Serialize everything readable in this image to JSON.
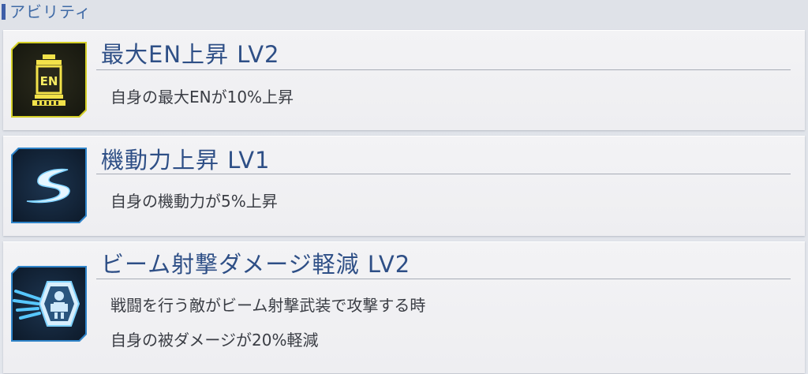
{
  "section": {
    "title": "アビリティ"
  },
  "abilities": [
    {
      "icon": "en-battery-icon",
      "title": "最大EN上昇 LV2",
      "description_lines": [
        "自身の最大ENが10%上昇"
      ],
      "icon_label": "EN",
      "frame_color": "#d4cf28"
    },
    {
      "icon": "mobility-swoosh-icon",
      "title": "機動力上昇 LV1",
      "description_lines": [
        "自身の機動力が5%上昇"
      ],
      "frame_color": "#2f84c9"
    },
    {
      "icon": "beam-shield-icon",
      "title": "ビーム射撃ダメージ軽減 LV2",
      "description_lines": [
        "戦闘を行う敵がビーム射撃武装で攻撃する時",
        "自身の被ダメージが20%軽減"
      ],
      "frame_color": "#2f84c9"
    }
  ],
  "colors": {
    "title_text": "#2e4f86",
    "header_accent": "#3e5ea8",
    "desc_text": "#3a3d44"
  }
}
